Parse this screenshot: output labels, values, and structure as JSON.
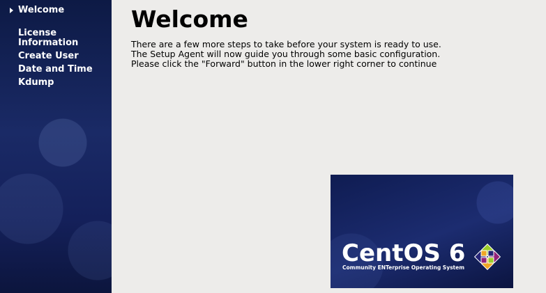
{
  "sidebar": {
    "items": [
      {
        "label": "Welcome",
        "active": true
      },
      {
        "label": "License\nInformation",
        "active": false
      },
      {
        "label": "Create User",
        "active": false
      },
      {
        "label": "Date and Time",
        "active": false
      },
      {
        "label": "Kdump",
        "active": false
      }
    ]
  },
  "main": {
    "title": "Welcome",
    "lines": [
      "There are a few more steps to take before your system is ready to use.",
      "The Setup Agent will now guide you through some basic configuration.",
      "Please click the \"Forward\" button in the lower right corner to continue"
    ]
  },
  "logo": {
    "wordmark": "CentOS 6",
    "tagline": "Community ENTerprise Operating System",
    "mark_icon": "centos-logo-icon",
    "colors": [
      "#9ccd2a",
      "#932279",
      "#efa724",
      "#262577"
    ]
  },
  "colors": {
    "sidebar_bg": "#13215b",
    "content_bg": "#edecea"
  }
}
